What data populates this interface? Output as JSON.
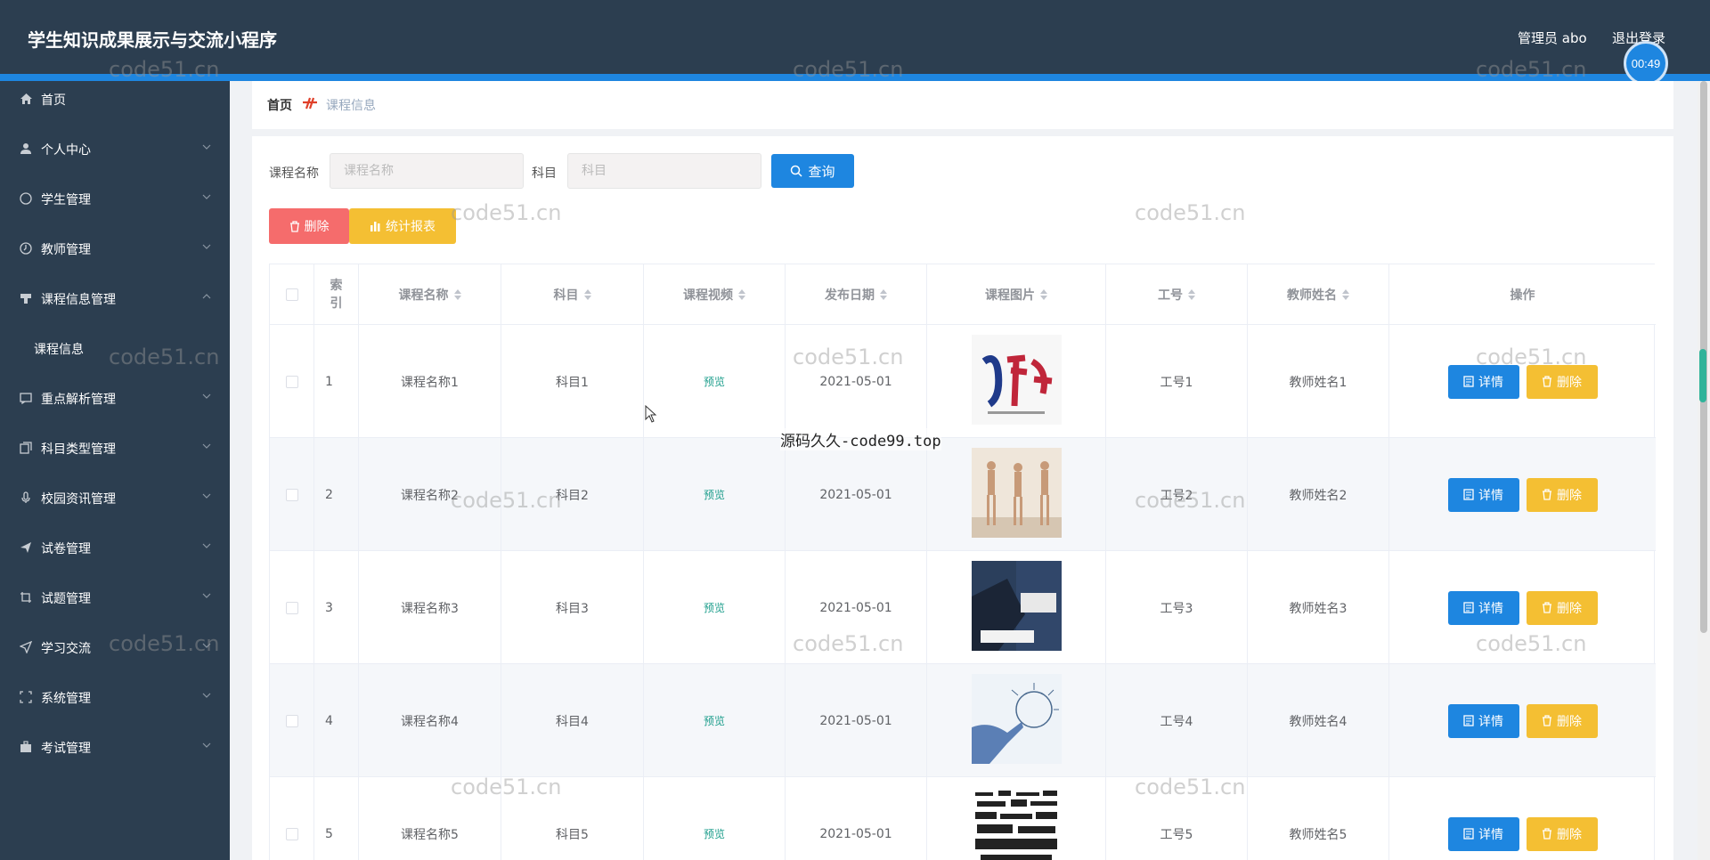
{
  "header": {
    "title": "学生知识成果展示与交流小程序",
    "user": "管理员 abo",
    "logout": "退出登录",
    "timer": "00:49"
  },
  "sidebar": {
    "items": [
      {
        "label": "首页",
        "icon": "home-icon"
      },
      {
        "label": "个人中心",
        "icon": "user-icon"
      },
      {
        "label": "学生管理",
        "icon": "compass-icon"
      },
      {
        "label": "教师管理",
        "icon": "clock-icon"
      },
      {
        "label": "课程信息管理",
        "icon": "cup-icon"
      },
      {
        "label": "重点解析管理",
        "icon": "message-icon"
      },
      {
        "label": "科目类型管理",
        "icon": "copy-icon"
      },
      {
        "label": "校园资讯管理",
        "icon": "microphone-icon"
      },
      {
        "label": "试卷管理",
        "icon": "send-icon"
      },
      {
        "label": "试题管理",
        "icon": "crop-icon"
      },
      {
        "label": "学习交流",
        "icon": "location-icon"
      },
      {
        "label": "系统管理",
        "icon": "fullscreen-icon"
      },
      {
        "label": "考试管理",
        "icon": "suitcase-icon"
      }
    ],
    "sub_item": "课程信息"
  },
  "breadcrumb": {
    "home": "首页",
    "current": "课程信息"
  },
  "search": {
    "course_label": "课程名称",
    "course_placeholder": "课程名称",
    "subject_label": "科目",
    "subject_placeholder": "科目",
    "query_button": "查询"
  },
  "actions": {
    "delete": "删除",
    "stats": "统计报表"
  },
  "table": {
    "headers": {
      "index": "索引",
      "name": "课程名称",
      "subject": "科目",
      "video": "课程视频",
      "date": "发布日期",
      "image": "课程图片",
      "job_no": "工号",
      "teacher": "教师姓名",
      "ops": "操作"
    },
    "rows": [
      {
        "index": "1",
        "name": "课程名称1",
        "subject": "科目1",
        "video": "预览",
        "date": "2021-05-01",
        "image": "calligraphy-poster-image",
        "job_no": "工号1",
        "teacher": "教师姓名1",
        "detail": "详情",
        "delete": "删除"
      },
      {
        "index": "2",
        "name": "课程名称2",
        "subject": "科目2",
        "video": "预览",
        "date": "2021-05-01",
        "image": "dancers-image",
        "job_no": "工号2",
        "teacher": "教师姓名2",
        "detail": "详情",
        "delete": "删除"
      },
      {
        "index": "3",
        "name": "课程名称3",
        "subject": "科目3",
        "video": "预览",
        "date": "2021-05-01",
        "image": "business-person-image",
        "job_no": "工号3",
        "teacher": "教师姓名3",
        "detail": "详情",
        "delete": "删除"
      },
      {
        "index": "4",
        "name": "课程名称4",
        "subject": "科目4",
        "video": "预览",
        "date": "2021-05-01",
        "image": "business-training-image",
        "job_no": "工号4",
        "teacher": "教师姓名4",
        "detail": "详情",
        "delete": "删除"
      },
      {
        "index": "5",
        "name": "课程名称5",
        "subject": "科目5",
        "video": "预览",
        "date": "2021-05-01",
        "image": "vocabulary-words-image",
        "job_no": "工号5",
        "teacher": "教师姓名5",
        "detail": "详情",
        "delete": "删除"
      }
    ]
  },
  "watermarks": {
    "code51": "code51.cn",
    "center": "源码久久-code99.top"
  },
  "colors": {
    "header_bg": "#2c3e50",
    "primary": "#1e86e0",
    "danger": "#f56c6c",
    "warning": "#f4bf33",
    "preview": "#1e9e8c"
  }
}
